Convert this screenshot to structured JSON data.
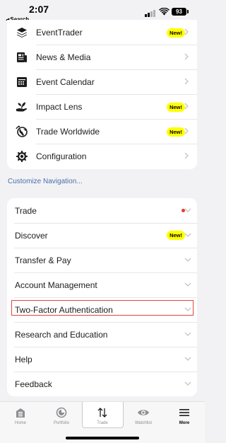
{
  "status_bar": {
    "time": "2:07",
    "back_label": "Search",
    "battery": "93"
  },
  "top_menu": {
    "items": [
      {
        "label": "EventTrader",
        "icon": "layers-icon",
        "badge": "New!"
      },
      {
        "label": "News & Media",
        "icon": "newspaper-icon",
        "badge": ""
      },
      {
        "label": "Event Calendar",
        "icon": "calendar-icon",
        "badge": ""
      },
      {
        "label": "Impact Lens",
        "icon": "hand-plant-icon",
        "badge": "New!"
      },
      {
        "label": "Trade Worldwide",
        "icon": "globe-icon",
        "badge": "New!"
      },
      {
        "label": "Configuration",
        "icon": "gear-icon",
        "badge": ""
      }
    ]
  },
  "customize_link": "Customize Navigation...",
  "sections": {
    "items": [
      {
        "label": "Trade",
        "indicator": "red-dot"
      },
      {
        "label": "Discover",
        "badge": "New!"
      },
      {
        "label": "Transfer & Pay"
      },
      {
        "label": "Account Management"
      },
      {
        "label": "Two-Factor Authentication",
        "highlighted": true
      },
      {
        "label": "Research and Education"
      },
      {
        "label": "Help"
      },
      {
        "label": "Feedback"
      }
    ]
  },
  "tab_bar": {
    "tabs": [
      {
        "label": "Home",
        "icon": "home-icon"
      },
      {
        "label": "Portfolio",
        "icon": "portfolio-icon"
      },
      {
        "label": "Trade",
        "icon": "trade-arrows-icon"
      },
      {
        "label": "Watchlist",
        "icon": "eye-icon"
      },
      {
        "label": "More",
        "icon": "hamburger-icon",
        "active": true
      }
    ]
  },
  "colors": {
    "accent_link": "#4a6fa5",
    "new_badge": "#ffff00",
    "highlight_border": "#e0453d",
    "red_dot": "#e53935"
  }
}
